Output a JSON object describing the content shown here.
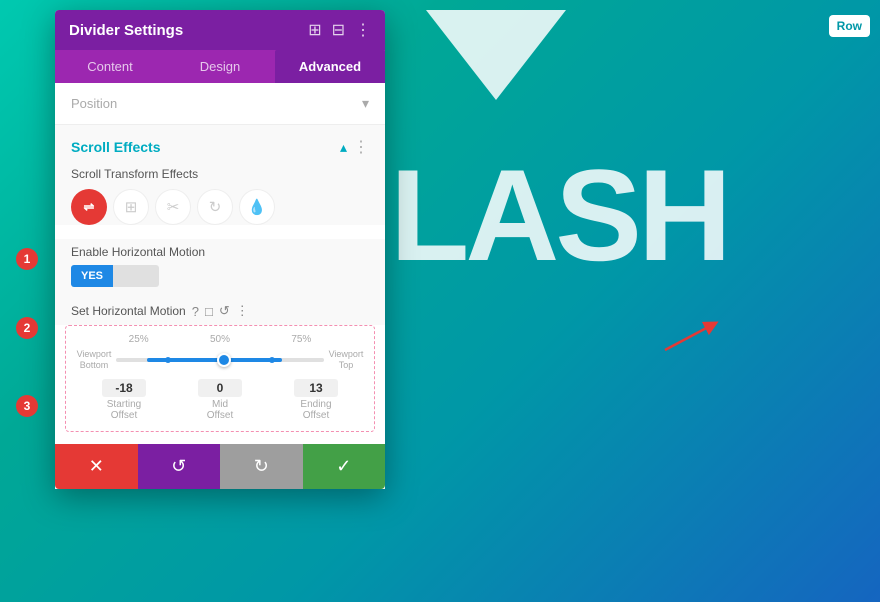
{
  "background": {
    "color_start": "#00c9b0",
    "color_end": "#1565c0"
  },
  "bg_text": "LASH",
  "row_badge": "Row",
  "panel": {
    "title": "Divider Settings",
    "tabs": [
      {
        "label": "Content",
        "active": false
      },
      {
        "label": "Design",
        "active": false
      },
      {
        "label": "Advanced",
        "active": true
      }
    ],
    "position_label": "Position",
    "scroll_effects": {
      "title": "Scroll Effects",
      "subsection_transform_label": "Scroll Transform Effects",
      "effect_buttons": [
        {
          "icon": "⇌",
          "active": true,
          "label": "horizontal-motion"
        },
        {
          "icon": "⊞",
          "active": false,
          "label": "vertical-motion"
        },
        {
          "icon": "✂",
          "active": false,
          "label": "fade"
        },
        {
          "icon": "↻",
          "active": false,
          "label": "rotate"
        },
        {
          "icon": "💧",
          "active": false,
          "label": "blur"
        }
      ],
      "enable_horizontal_label": "Enable Horizontal Motion",
      "toggle_yes": "YES",
      "toggle_no": "",
      "set_horizontal_label": "Set Horizontal Motion",
      "slider_pct_labels": [
        "25%",
        "50%",
        "75%"
      ],
      "viewport_bottom": "Viewport\nBottom",
      "viewport_top": "Viewport\nTop",
      "offsets": [
        {
          "value": "-18",
          "sublabel": "Starting\nOffset"
        },
        {
          "value": "0",
          "sublabel": "Mid\nOffset"
        },
        {
          "value": "13",
          "sublabel": "Ending\nOffset"
        }
      ]
    },
    "footer": {
      "cancel_label": "✕",
      "undo_label": "↺",
      "redo_label": "↻",
      "save_label": "✓"
    }
  },
  "numbered_labels": [
    "1",
    "2",
    "3"
  ]
}
